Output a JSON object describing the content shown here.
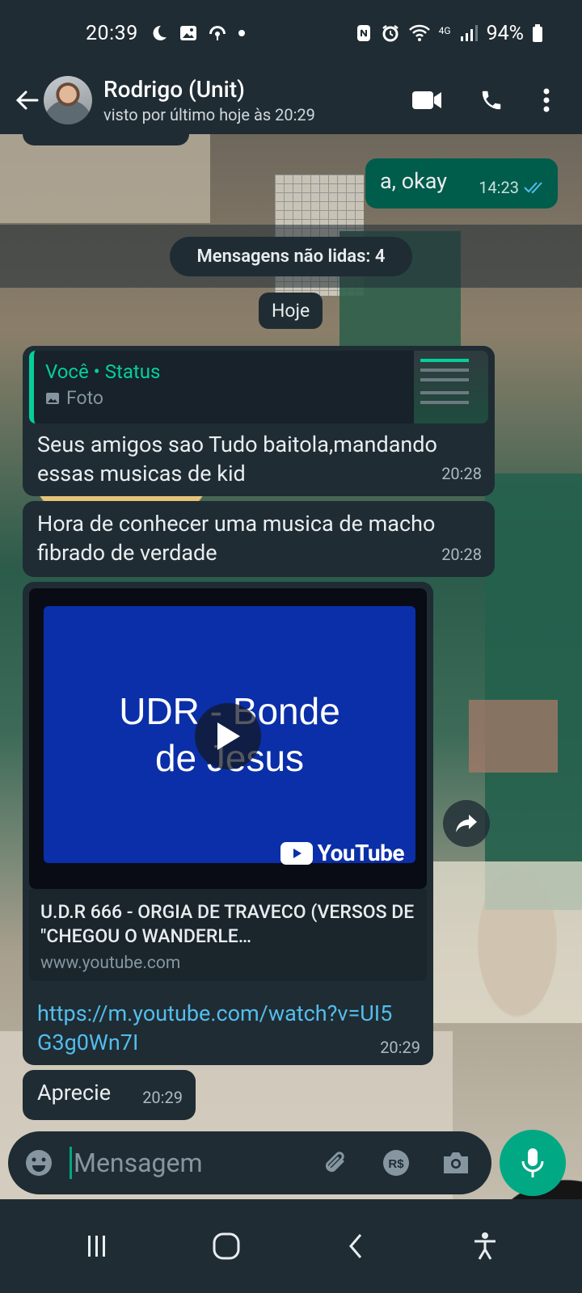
{
  "status_bar": {
    "time": "20:39",
    "network": "4G",
    "battery": "94%"
  },
  "header": {
    "name": "Rodrigo (Unit)",
    "last_seen": "visto por último hoje às 20:29"
  },
  "chat": {
    "top_partial_time": "14:23",
    "outgoing": {
      "text": "a, okay",
      "time": "14:23"
    },
    "unread_label": "Mensagens não lidas: 4",
    "date_chip": "Hoje",
    "reply": {
      "quote_title": "Você • Status",
      "quote_sub": "Foto",
      "text": "Seus amigos sao Tudo baitola,mandando essas musicas de kid",
      "time": "20:28"
    },
    "message2": {
      "text": "Hora de conhecer uma musica de macho fibrado de verdade",
      "time": "20:28"
    },
    "link_preview": {
      "thumb_text_line1": "UDR - Bonde",
      "thumb_text_line2": "de Jesus",
      "youtube_label": "YouTube",
      "title": "U.D.R 666 - ORGIA DE TRAVECO (VERSOS DE \"CHEGOU O WANDERLE…",
      "domain": "www.youtube.com",
      "url": "https://m.youtube.com/watch?v=UI5G3g0Wn7I",
      "time": "20:29"
    },
    "message4": {
      "text": "Aprecie",
      "time": "20:29"
    }
  },
  "composer": {
    "placeholder": "Mensagem"
  },
  "colors": {
    "accent": "#00a884",
    "outgoing_bubble": "#005c4b",
    "incoming_bubble": "#1f2c34",
    "link": "#53bdeb"
  }
}
